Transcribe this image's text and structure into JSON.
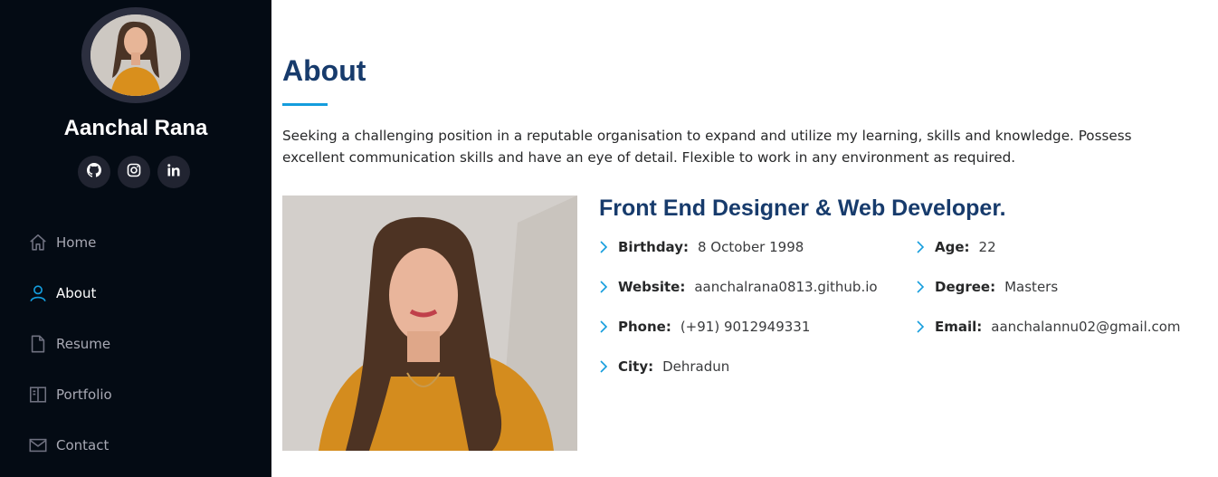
{
  "profile": {
    "name": "Aanchal Rana",
    "socials": [
      {
        "icon": "github-icon"
      },
      {
        "icon": "instagram-icon"
      },
      {
        "icon": "linkedin-icon"
      }
    ]
  },
  "nav": {
    "items": [
      {
        "label": "Home",
        "icon": "home-icon",
        "active": false
      },
      {
        "label": "About",
        "icon": "person-icon",
        "active": true
      },
      {
        "label": "Resume",
        "icon": "file-icon",
        "active": false
      },
      {
        "label": "Portfolio",
        "icon": "book-half-icon",
        "active": false
      },
      {
        "label": "Contact",
        "icon": "envelope-icon",
        "active": false
      }
    ]
  },
  "about": {
    "title": "About",
    "intro": "Seeking a challenging position in a reputable organisation to expand and utilize my learning, skills and knowledge. Possess excellent communication skills and have an eye of detail. Flexible to work in any environment as required.",
    "role": "Front End Designer & Web Developer.",
    "details": [
      {
        "key": "Birthday:",
        "value": "8 October 1998"
      },
      {
        "key": "Age:",
        "value": "22"
      },
      {
        "key": "Website:",
        "value": "aanchalrana0813.github.io"
      },
      {
        "key": "Degree:",
        "value": "Masters"
      },
      {
        "key": "Phone:",
        "value": "(+91) 9012949331"
      },
      {
        "key": "Email:",
        "value": "aanchalannu02@gmail.com"
      },
      {
        "key": "City:",
        "value": "Dehradun"
      }
    ]
  },
  "colors": {
    "sidebar_bg": "#040b14",
    "accent": "#149ddd",
    "heading": "#173b6c"
  }
}
